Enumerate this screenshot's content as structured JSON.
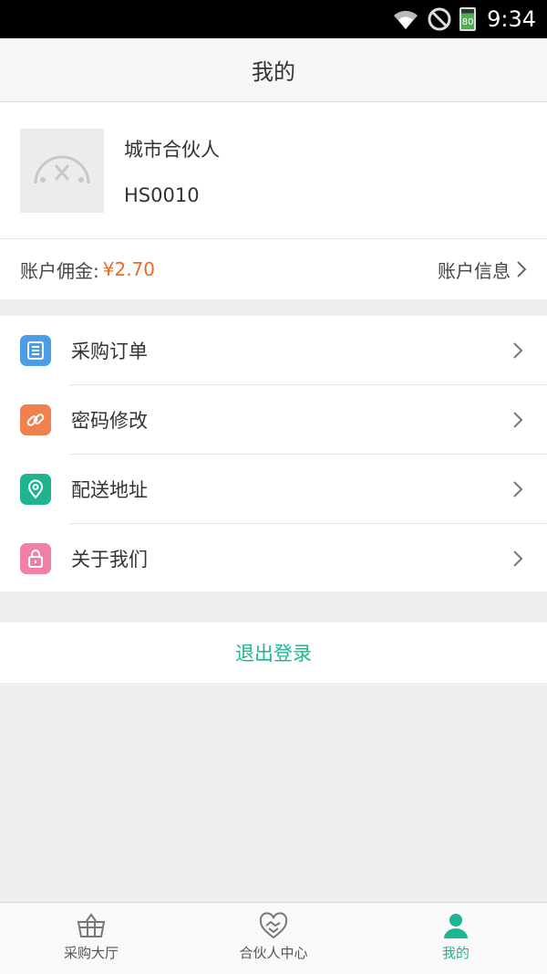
{
  "status_bar": {
    "time": "9:34",
    "battery": "80"
  },
  "nav": {
    "title": "我的"
  },
  "profile": {
    "name": "城市合伙人",
    "id": "HS0010"
  },
  "account": {
    "commission_label": "账户佣金:",
    "commission_value": "¥2.70",
    "info_label": "账户信息"
  },
  "menu": {
    "items": [
      {
        "label": "采购订单",
        "icon": "order-list-icon",
        "color": "#4a9de6"
      },
      {
        "label": "密码修改",
        "icon": "link-icon",
        "color": "#f0814e"
      },
      {
        "label": "配送地址",
        "icon": "location-pin-icon",
        "color": "#1fb48f"
      },
      {
        "label": "关于我们",
        "icon": "lock-icon",
        "color": "#f27fa6"
      }
    ]
  },
  "logout": {
    "label": "退出登录"
  },
  "tabs": [
    {
      "label": "采购大厅",
      "icon": "basket-icon"
    },
    {
      "label": "合伙人中心",
      "icon": "handshake-heart-icon"
    },
    {
      "label": "我的",
      "icon": "user-icon",
      "active": true
    }
  ],
  "colors": {
    "accent": "#1bb794",
    "price": "#ef6a1f"
  }
}
